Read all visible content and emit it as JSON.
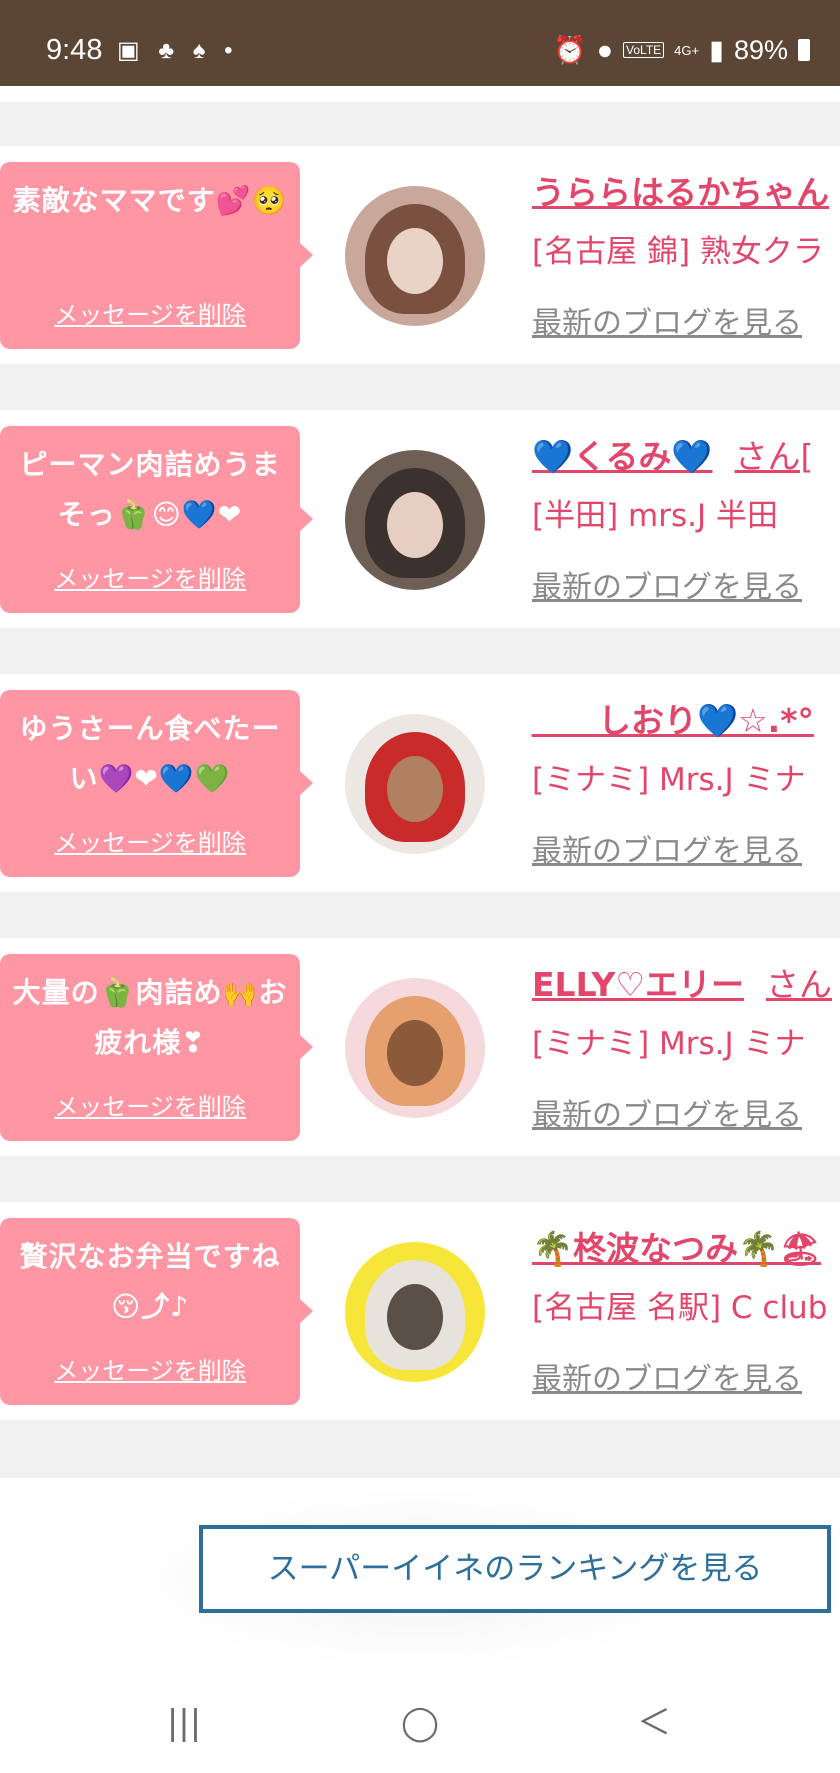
{
  "status_bar": {
    "time": "9:48",
    "left_icons": [
      "gallery-icon",
      "app-icon",
      "app-icon",
      "dot-icon"
    ],
    "volte": "VoLTE",
    "network": "4G+",
    "battery": "89%"
  },
  "messages": [
    {
      "bubble_text": "素敵なママです💕🥺",
      "delete_label": "メッセージを削除",
      "name": "うららはるかちゃん",
      "san": "",
      "shop": "[名古屋 錦] 熟女クラ",
      "blog_label": "最新のブログを見る",
      "avatar_colors": [
        "#c9a79a",
        "#7a5040",
        "#e9d3c7"
      ]
    },
    {
      "bubble_text": "ピーマン肉詰めうまそっ🫑😊💙❤",
      "delete_label": "メッセージを削除",
      "name": "💙くるみ💙",
      "san": "さん[",
      "shop": "[半田] mrs.J 半田",
      "blog_label": "最新のブログを見る",
      "avatar_colors": [
        "#6e5f55",
        "#3b3230",
        "#e6cfc2"
      ]
    },
    {
      "bubble_text": "ゆうさーん食べたーい💜❤💙💚",
      "delete_label": "メッセージを削除",
      "name": "＿＿しおり💙☆.*°",
      "san": "",
      "shop": "[ミナミ] Mrs.J ミナ",
      "blog_label": "最新のブログを見る",
      "avatar_colors": [
        "#ece7e3",
        "#c92a2a",
        "#b08060"
      ]
    },
    {
      "bubble_text": "大量の🫑肉詰め🙌お疲れ様❣",
      "delete_label": "メッセージを削除",
      "name": "ELLY♡エリー",
      "san": "さん",
      "shop": "[ミナミ] Mrs.J ミナ",
      "blog_label": "最新のブログを見る",
      "avatar_colors": [
        "#f5d9dd",
        "#e6a070",
        "#8a5a3a"
      ]
    },
    {
      "bubble_text": "贅沢なお弁当ですね😚⤴♪",
      "delete_label": "メッセージを削除",
      "name": "🌴柊波なつみ🌴🏖",
      "san": "",
      "shop": "[名古屋 名駅] C club",
      "blog_label": "最新のブログを見る",
      "avatar_colors": [
        "#f6e63a",
        "#e8e2dc",
        "#5a5048"
      ]
    }
  ],
  "ranking_button": "スーパーイイネのランキングを見る",
  "nav": {
    "recent": "|||",
    "home": "◯",
    "back": "＜"
  }
}
